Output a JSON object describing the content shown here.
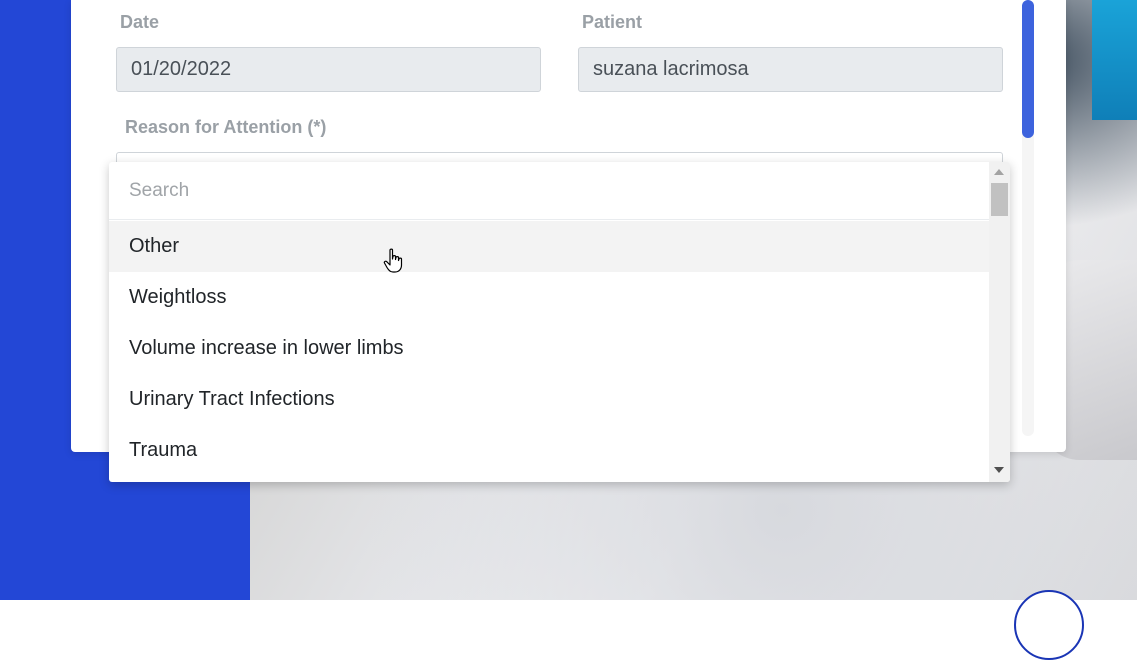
{
  "form": {
    "date_label": "Date",
    "date_value": "01/20/2022",
    "patient_label": "Patient",
    "patient_value": "suzana lacrimosa",
    "reason_label": "Reason for Attention (*)"
  },
  "dropdown": {
    "search_placeholder": "Search",
    "options": [
      "Other",
      "Weightloss",
      "Volume increase in lower limbs",
      "Urinary Tract Infections",
      "Trauma"
    ],
    "hovered_option": "Other"
  },
  "colors": {
    "accent_blue": "#2347d6",
    "scrollbar_blue": "#3d63dd"
  },
  "icons": {
    "cursor": "hand-pointer-icon",
    "scroll_up": "triangle-up-icon",
    "scroll_down": "triangle-down-icon"
  }
}
